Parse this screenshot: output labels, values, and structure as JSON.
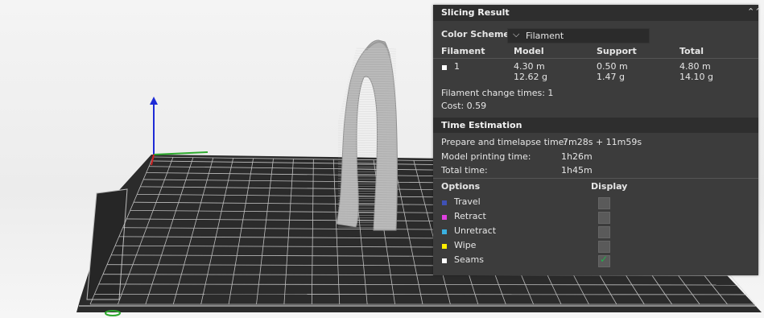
{
  "panel": {
    "title": "Slicing Result",
    "collapse_icon": "double-chevron-up-icon",
    "color_scheme_label": "Color Scheme",
    "color_scheme_value": "Filament",
    "filament_table": {
      "headers": [
        "Filament",
        "Model",
        "Support",
        "Total"
      ],
      "rows": [
        {
          "swatch_color": "#ffffff",
          "name": "1",
          "model_len": "4.30 m",
          "model_weight": "12.62 g",
          "support_len": "0.50 m",
          "support_weight": "1.47 g",
          "total_len": "4.80 m",
          "total_weight": "14.10 g"
        }
      ]
    },
    "filament_change": "Filament change times:  1",
    "cost": "Cost:  0.59",
    "time_header": "Time Estimation",
    "prepare_label": "Prepare and timelapse time:",
    "prepare_value": "7m28s + 11m59s",
    "model_time_label": "Model printing time:",
    "model_time_value": "1h26m",
    "total_time_label": "Total time:",
    "total_time_value": "1h45m",
    "options_header": "Options",
    "display_header": "Display",
    "options": [
      {
        "label": "Travel",
        "color": "#3f51b5",
        "checked": false
      },
      {
        "label": "Retract",
        "color": "#e040e0",
        "checked": false
      },
      {
        "label": "Unretract",
        "color": "#3ab0e0",
        "checked": false
      },
      {
        "label": "Wipe",
        "color": "#ffee00",
        "checked": false
      },
      {
        "label": "Seams",
        "color": "#ffffff",
        "checked": true
      }
    ]
  },
  "colors": {
    "panel_bg": "#3c3c3c",
    "header_bg": "#2e2e2e",
    "plate": "#2a2a2a",
    "model": "#b8b8b8",
    "axis_x": "#2eaa2e",
    "axis_y": "#d12020",
    "axis_z": "#1e2bd6",
    "check": "#22b14c"
  }
}
